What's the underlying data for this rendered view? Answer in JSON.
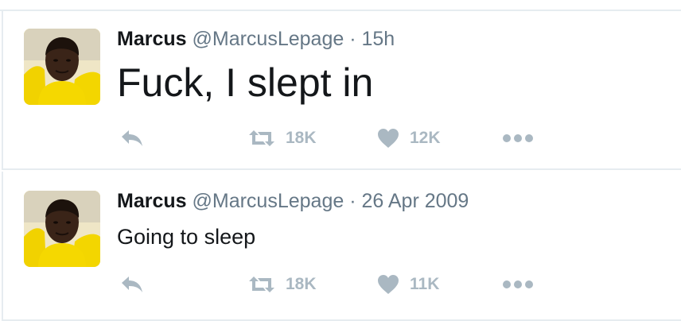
{
  "tweets": [
    {
      "author": {
        "name": "Marcus",
        "handle": "@MarcusLepage"
      },
      "separator": "·",
      "time": "15h",
      "text": "Fuck, I slept in",
      "retweets": "18K",
      "likes": "12K"
    },
    {
      "author": {
        "name": "Marcus",
        "handle": "@MarcusLepage"
      },
      "separator": "·",
      "time": "26 Apr 2009",
      "text": "Going to sleep",
      "retweets": "18K",
      "likes": "11K"
    }
  ],
  "icons": {
    "reply": "reply-icon",
    "retweet": "retweet-icon",
    "like": "heart-icon",
    "more": "more-dots-icon"
  },
  "colors": {
    "text": "#14171a",
    "secondary": "#657786",
    "action": "#aab8c2",
    "divider": "#e6ecf0",
    "avatar_background": "#f3d600"
  }
}
